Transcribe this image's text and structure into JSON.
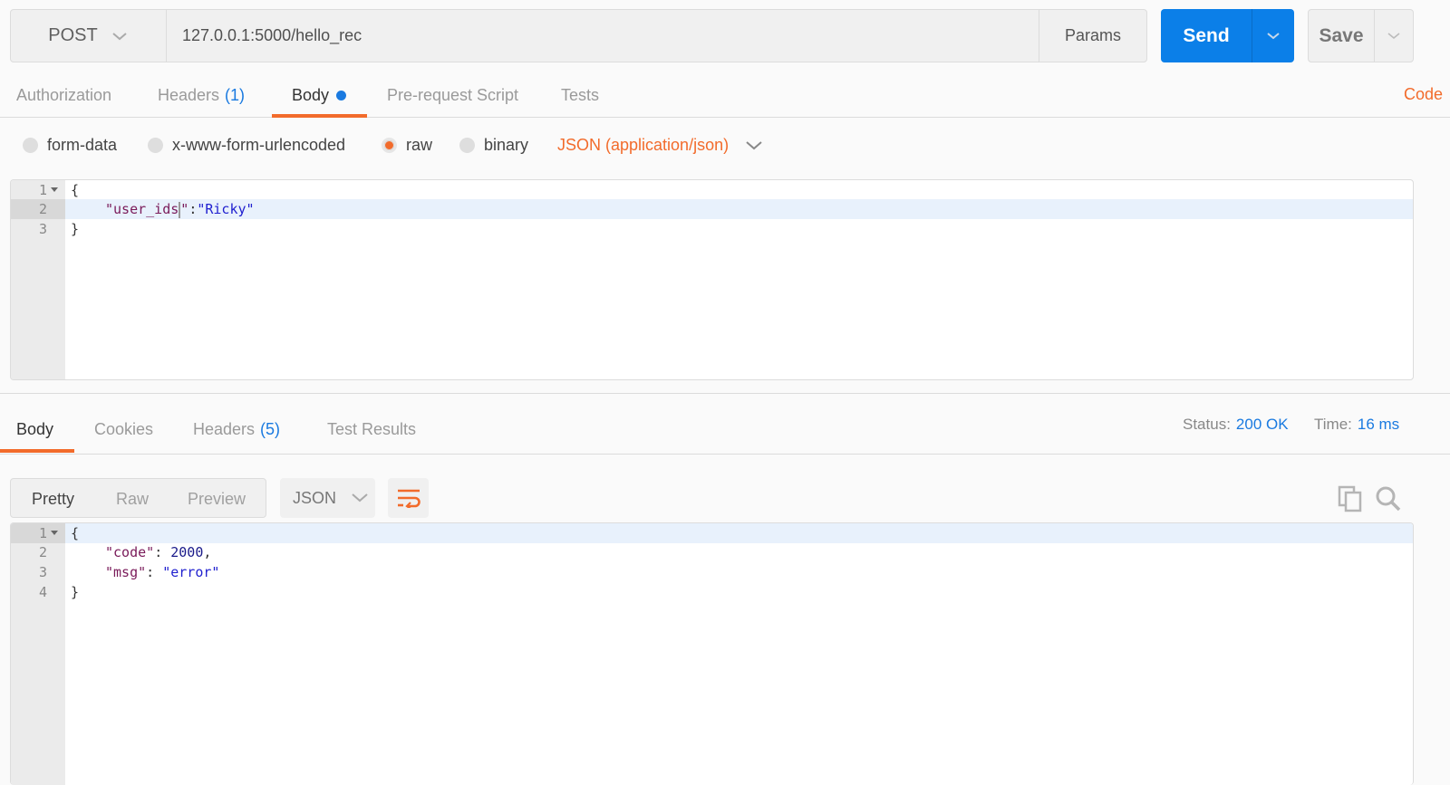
{
  "request": {
    "method": "POST",
    "url": "127.0.0.1:5000/hello_rec",
    "params_label": "Params",
    "send_label": "Send",
    "save_label": "Save"
  },
  "request_tabs": [
    {
      "label": "Authorization",
      "count": null,
      "active": false
    },
    {
      "label": "Headers",
      "count": "(1)",
      "active": false
    },
    {
      "label": "Body",
      "count": null,
      "active": true,
      "modified_dot": true
    },
    {
      "label": "Pre-request Script",
      "count": null,
      "active": false
    },
    {
      "label": "Tests",
      "count": null,
      "active": false
    }
  ],
  "code_link": "Code",
  "body_types": [
    {
      "label": "form-data",
      "checked": false
    },
    {
      "label": "x-www-form-urlencoded",
      "checked": false
    },
    {
      "label": "raw",
      "checked": true
    },
    {
      "label": "binary",
      "checked": false
    }
  ],
  "raw_format": "JSON (application/json)",
  "request_body": {
    "line_numbers": [
      "1",
      "2",
      "3"
    ],
    "line1": "{",
    "line2_key": "\"user_ids",
    "line2_key_end": "\"",
    "line2_sep": ":",
    "line2_value": "\"Ricky\"",
    "line3": "}"
  },
  "response_tabs": [
    {
      "label": "Body",
      "count": null,
      "active": true
    },
    {
      "label": "Cookies",
      "count": null,
      "active": false
    },
    {
      "label": "Headers",
      "count": "(5)",
      "active": false
    },
    {
      "label": "Test Results",
      "count": null,
      "active": false
    }
  ],
  "response_meta": {
    "status_label": "Status:",
    "status_value": "200 OK",
    "time_label": "Time:",
    "time_value": "16 ms"
  },
  "response_view": {
    "modes": [
      "Pretty",
      "Raw",
      "Preview"
    ],
    "active_mode": "Pretty",
    "language": "JSON"
  },
  "response_body": {
    "line_numbers": [
      "1",
      "2",
      "3",
      "4"
    ],
    "line1": "{",
    "line2_key": "\"code\"",
    "line2_sep": ": ",
    "line2_value": "2000",
    "line2_end": ",",
    "line3_key": "\"msg\"",
    "line3_sep": ": ",
    "line3_value": "\"error\"",
    "line4": "}"
  },
  "colors": {
    "accent": "#f26b2b",
    "primary": "#0b7fe8",
    "link_blue": "#1a7ae0"
  }
}
